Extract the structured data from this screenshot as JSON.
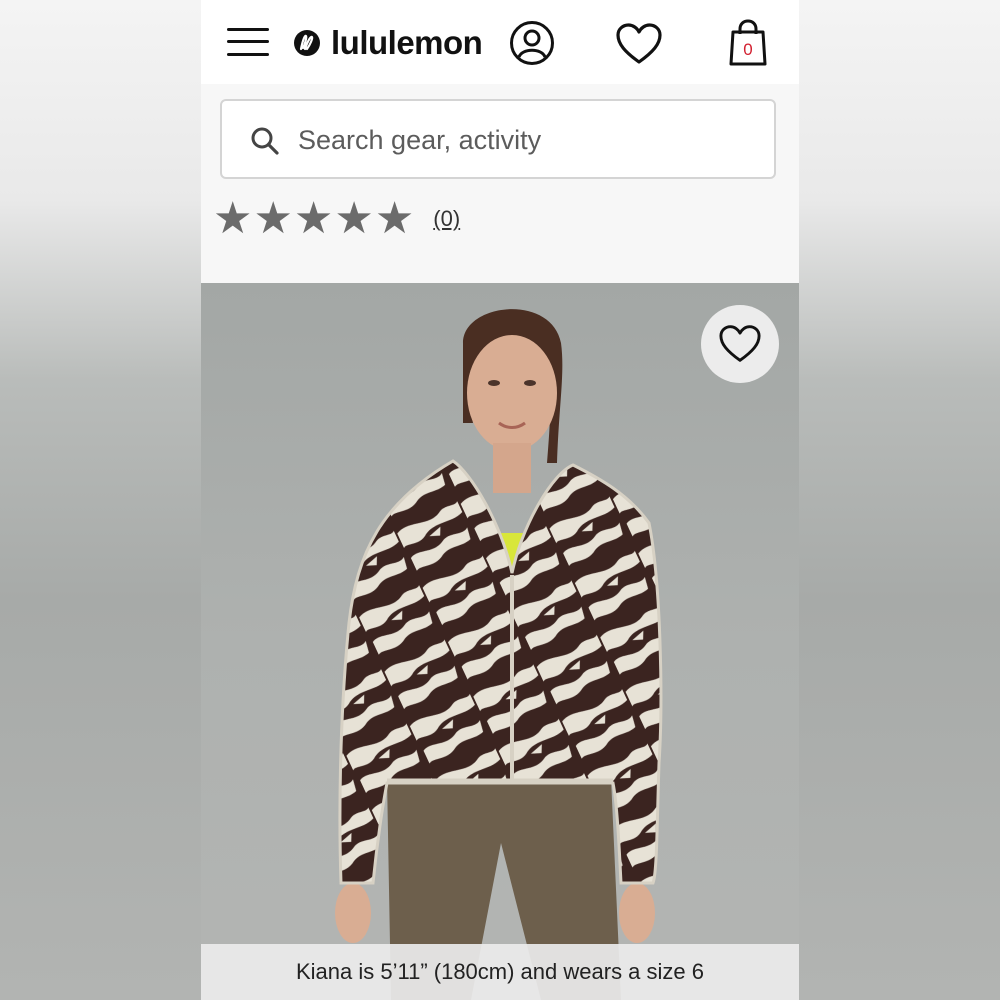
{
  "header": {
    "brand": "lululemon",
    "bag_count": "0"
  },
  "search": {
    "placeholder": "Search gear, activity"
  },
  "rating": {
    "stars": 5,
    "review_count_label": "(0)"
  },
  "product_image": {
    "caption": "Kiana is 5’11” (180cm) and wears a size 6"
  },
  "icons": [
    "menu-icon",
    "lululemon-logo-icon",
    "account-icon",
    "heart-icon",
    "shopping-bag-icon",
    "search-icon",
    "star-icon"
  ],
  "colors": {
    "brand_red": "#d22030",
    "text": "#111111",
    "star": "#6b6b6b"
  }
}
